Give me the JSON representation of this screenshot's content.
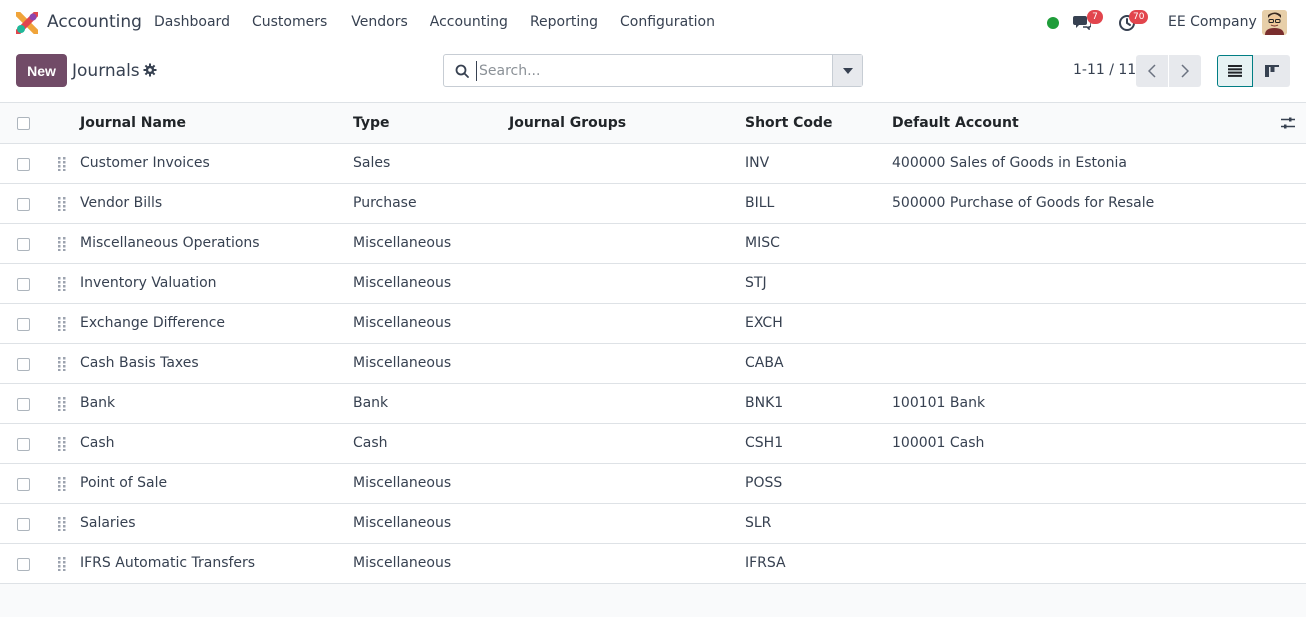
{
  "app": {
    "name": "Accounting",
    "menu": [
      "Dashboard",
      "Customers",
      "Vendors",
      "Accounting",
      "Reporting",
      "Configuration"
    ],
    "chat_count": "7",
    "activity_count": "70",
    "company": "EE Company"
  },
  "control": {
    "new_label": "New",
    "title": "Journals",
    "search_placeholder": "Search...",
    "pager": "1-11 / 11"
  },
  "table": {
    "headers": [
      "Journal Name",
      "Type",
      "Journal Groups",
      "Short Code",
      "Default Account"
    ],
    "rows": [
      {
        "name": "Customer Invoices",
        "type": "Sales",
        "group": "",
        "code": "INV",
        "account": "400000 Sales of Goods in Estonia"
      },
      {
        "name": "Vendor Bills",
        "type": "Purchase",
        "group": "",
        "code": "BILL",
        "account": "500000 Purchase of Goods for Resale"
      },
      {
        "name": "Miscellaneous Operations",
        "type": "Miscellaneous",
        "group": "",
        "code": "MISC",
        "account": ""
      },
      {
        "name": "Inventory Valuation",
        "type": "Miscellaneous",
        "group": "",
        "code": "STJ",
        "account": ""
      },
      {
        "name": "Exchange Difference",
        "type": "Miscellaneous",
        "group": "",
        "code": "EXCH",
        "account": ""
      },
      {
        "name": "Cash Basis Taxes",
        "type": "Miscellaneous",
        "group": "",
        "code": "CABA",
        "account": ""
      },
      {
        "name": "Bank",
        "type": "Bank",
        "group": "",
        "code": "BNK1",
        "account": "100101 Bank"
      },
      {
        "name": "Cash",
        "type": "Cash",
        "group": "",
        "code": "CSH1",
        "account": "100001 Cash"
      },
      {
        "name": "Point of Sale",
        "type": "Miscellaneous",
        "group": "",
        "code": "POSS",
        "account": ""
      },
      {
        "name": "Salaries",
        "type": "Miscellaneous",
        "group": "",
        "code": "SLR",
        "account": ""
      },
      {
        "name": "IFRS Automatic Transfers",
        "type": "Miscellaneous",
        "group": "",
        "code": "IFRSA",
        "account": ""
      }
    ]
  },
  "colors": {
    "brand": "#714b67",
    "accent": "#017e84",
    "online": "#1f9d3a",
    "badge": "#e2454d"
  },
  "icons": [
    "app-logo-icon",
    "chat-icon",
    "clock-icon",
    "gear-icon",
    "search-icon",
    "caret-down-icon",
    "chevron-left-icon",
    "chevron-right-icon",
    "list-view-icon",
    "kanban-view-icon",
    "drag-handle-icon",
    "column-settings-icon"
  ]
}
